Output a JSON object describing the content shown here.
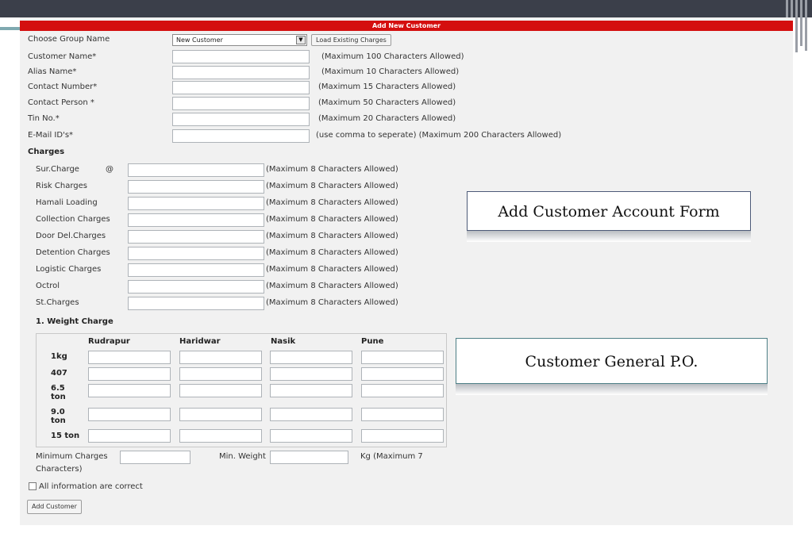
{
  "form": {
    "title": "Add New Customer",
    "group": {
      "label": "Choose Group Name",
      "value": "New Customer",
      "load_button": "Load Existing Charges"
    },
    "fields": [
      {
        "label": "Customer Name*",
        "hint": "(Maximum 100 Characters Allowed)"
      },
      {
        "label": "Alias Name*",
        "hint": "(Maximum 10 Characters Allowed)"
      },
      {
        "label": "Contact Number*",
        "hint": "(Maximum 15 Characters Allowed)"
      },
      {
        "label": "Contact Person *",
        "hint": "(Maximum 50 Characters Allowed)"
      },
      {
        "label": "Tin No.*",
        "hint": "(Maximum 20 Characters Allowed)"
      },
      {
        "label": "E-Mail ID's*",
        "hint": "(use comma to seperate) (Maximum 200 Characters Allowed)"
      }
    ],
    "charges_heading": "Charges",
    "charges": [
      {
        "label": "Sur.Charge",
        "suffix": "@",
        "hint": "(Maximum 8 Characters Allowed)"
      },
      {
        "label": "Risk Charges",
        "hint": "(Maximum 8 Characters Allowed)"
      },
      {
        "label": "Hamali Loading",
        "hint": "(Maximum 8 Characters Allowed)"
      },
      {
        "label": "Collection Charges",
        "hint": "(Maximum 8 Characters Allowed)"
      },
      {
        "label": "Door Del.Charges",
        "hint": "(Maximum 8 Characters Allowed)"
      },
      {
        "label": "Detention Charges",
        "hint": "(Maximum 8 Characters Allowed)"
      },
      {
        "label": "Logistic Charges",
        "hint": "(Maximum 8 Characters Allowed)"
      },
      {
        "label": "Octrol",
        "hint": "(Maximum 8 Characters Allowed)"
      },
      {
        "label": "St.Charges",
        "hint": "(Maximum 8 Characters Allowed)"
      }
    ],
    "weight": {
      "heading": "1. Weight Charge",
      "columns": [
        "Rudrapur",
        "Haridwar",
        "Nasik",
        "Pune"
      ],
      "rows": [
        "1kg",
        "407",
        "6.5 ton",
        "9.0 ton",
        "15 ton"
      ]
    },
    "minimum": {
      "label_line1": "Minimum Charges",
      "label_line2": "Characters)",
      "min_weight_label": "Min. Weight",
      "unit_hint": "Kg (Maximum 7"
    },
    "confirm_label": "All information are correct",
    "submit_label": "Add Customer"
  },
  "callouts": {
    "account_form": "Add Customer Account Form",
    "general_po": "Customer General P.O."
  }
}
